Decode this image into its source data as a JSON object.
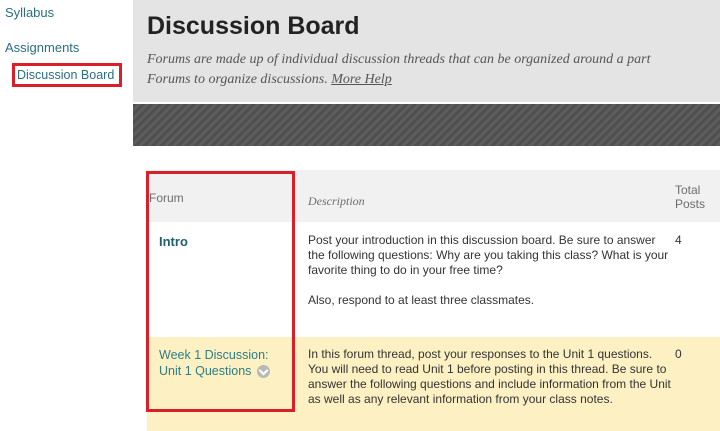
{
  "sidebar": {
    "items": [
      {
        "label": "Syllabus"
      },
      {
        "label": "Assignments"
      },
      {
        "label": "Discussion Board"
      }
    ]
  },
  "header": {
    "title": "Discussion Board",
    "description": "Forums are made up of individual discussion threads that can be organized around a part",
    "description_line2": "Forums to organize discussions.",
    "more_help": "More Help"
  },
  "table": {
    "columns": {
      "forum": "Forum",
      "description": "Description",
      "total_posts": "Total Posts"
    },
    "rows": [
      {
        "forum": "Intro",
        "description": "Post your introduction in this discussion board. Be sure to answer the following questions: Why are you taking this class? What is your favorite thing to do in your free time?",
        "description_extra": "Also, respond to at least three classmates.",
        "total_posts": "4"
      },
      {
        "forum": "Week 1 Discussion: Unit 1 Questions",
        "description": "In this forum thread, post your responses to the Unit 1 questions.  You will need to read Unit 1 before posting in this thread.  Be sure to answer the following questions and include information from the Unit as well as any relevant information from your class notes.",
        "total_posts": "0"
      }
    ]
  },
  "colors": {
    "highlight": "#d91f27",
    "link": "#2a6e86",
    "row_highlight": "#fdf1c4"
  },
  "icons": {
    "forum_menu": "chevron-down-icon"
  }
}
